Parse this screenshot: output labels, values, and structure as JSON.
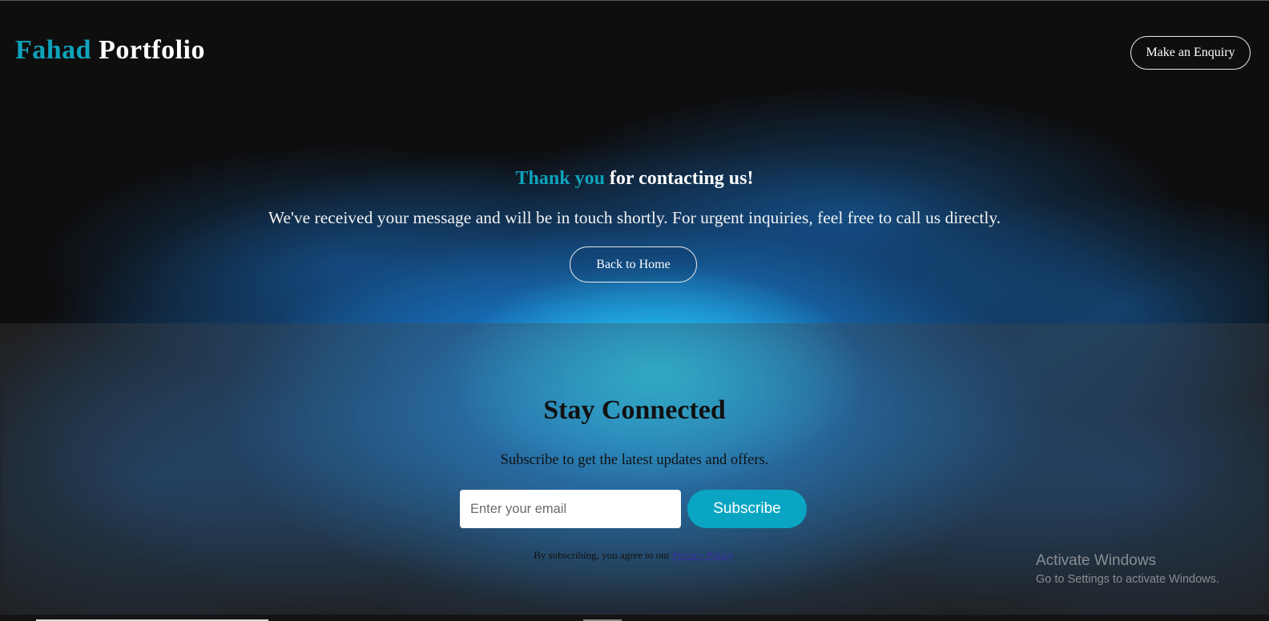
{
  "header": {
    "brand_first": "Fahad",
    "brand_second": "Portfolio",
    "enquiry_label": "Make an Enquiry"
  },
  "hero": {
    "title_accent": "Thank you",
    "title_rest": "for contacting us!",
    "message": "We've received your message and will be in touch shortly. For urgent inquiries, feel free to call us directly.",
    "back_label": "Back to Home"
  },
  "subscribe": {
    "title": "Stay Connected",
    "subtitle": "Subscribe to get the latest updates and offers.",
    "email_placeholder": "Enter your email",
    "email_value": "",
    "button_label": "Subscribe",
    "note_prefix": "By subscribing, you agree to our",
    "policy_link": "Privacy Policy",
    "note_suffix": "."
  },
  "watermark": {
    "title": "Activate Windows",
    "subtitle": "Go to Settings to activate Windows."
  },
  "colors": {
    "accent": "#0fa3bd",
    "background": "#0e0e0f",
    "subscribe_button": "#0aa5c2",
    "glow": "#1e9fff"
  }
}
